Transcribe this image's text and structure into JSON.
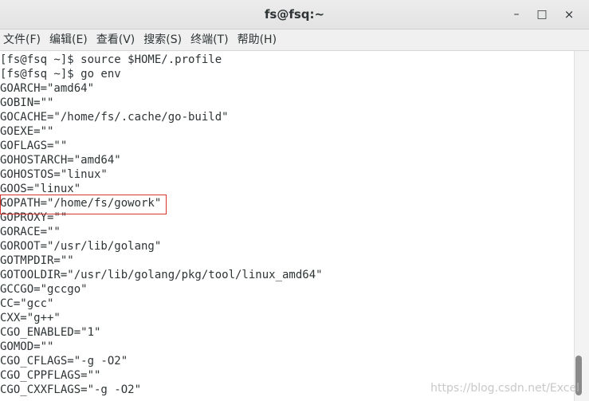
{
  "window": {
    "title": "fs@fsq:~",
    "controls": {
      "minimize": "–",
      "maximize": "□",
      "close": "×"
    }
  },
  "menu": {
    "items": [
      "文件(F)",
      "编辑(E)",
      "查看(V)",
      "搜索(S)",
      "终端(T)",
      "帮助(H)"
    ]
  },
  "terminal": {
    "lines": [
      "[fs@fsq ~]$ source $HOME/.profile",
      "[fs@fsq ~]$ go env",
      "GOARCH=\"amd64\"",
      "GOBIN=\"\"",
      "GOCACHE=\"/home/fs/.cache/go-build\"",
      "GOEXE=\"\"",
      "GOFLAGS=\"\"",
      "GOHOSTARCH=\"amd64\"",
      "GOHOSTOS=\"linux\"",
      "GOOS=\"linux\"",
      "GOPATH=\"/home/fs/gowork\"",
      "GOPROXY=\"\"",
      "GORACE=\"\"",
      "GOROOT=\"/usr/lib/golang\"",
      "GOTMPDIR=\"\"",
      "GOTOOLDIR=\"/usr/lib/golang/pkg/tool/linux_amd64\"",
      "GCCGO=\"gccgo\"",
      "CC=\"gcc\"",
      "CXX=\"g++\"",
      "CGO_ENABLED=\"1\"",
      "GOMOD=\"\"",
      "CGO_CFLAGS=\"-g -O2\"",
      "CGO_CPPFLAGS=\"\"",
      "CGO_CXXFLAGS=\"-g -O2\""
    ]
  },
  "watermark": "https://blog.csdn.net/Excel",
  "colors": {
    "highlight_border": "#d9342b",
    "text": "#2e3436"
  }
}
